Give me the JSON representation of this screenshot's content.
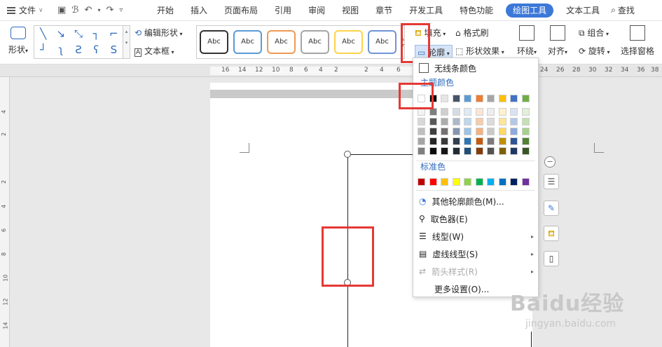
{
  "menubar": {
    "file_label": "文件",
    "tabs": [
      "开始",
      "插入",
      "页面布局",
      "引用",
      "审阅",
      "视图",
      "章节",
      "开发工具",
      "特色功能",
      "绘图工具",
      "文本工具"
    ],
    "active_tab": "绘图工具",
    "search_label": "查找"
  },
  "ribbon": {
    "shape_label": "形状",
    "edit_shape_label": "编辑形状",
    "textbox_label": "文本框",
    "style_samples": [
      "Abc",
      "Abc",
      "Abc",
      "Abc",
      "Abc",
      "Abc"
    ],
    "fill_label": "填充",
    "outline_label": "轮廓",
    "format_brush_label": "格式刷",
    "shape_effect_label": "形状效果",
    "wrap_label": "环绕",
    "align_label": "对齐",
    "group_label": "组合",
    "rotate_label": "旋转",
    "selection_pane_label": "选择窗格"
  },
  "ruler": {
    "h_ticks": [
      "16",
      "14",
      "12",
      "10",
      "8",
      "6",
      "4",
      "2",
      "2",
      "4",
      "6",
      "24",
      "26",
      "28",
      "30",
      "32",
      "34",
      "36",
      "38"
    ],
    "v_ticks": [
      "4",
      "2",
      "2",
      "4",
      "6",
      "8",
      "10",
      "12",
      "14"
    ]
  },
  "dropdown": {
    "no_line_color": "无线条颜色",
    "theme_colors_label": "主题颜色",
    "standard_colors_label": "标准色",
    "more_outline_colors": "其他轮廓颜色(M)...",
    "eyedropper": "取色器(E)",
    "line_type": "线型(W)",
    "dash_type": "虚线线型(S)",
    "arrow_style": "箭头样式(R)",
    "more_settings": "更多设置(O)..."
  },
  "theme_colors": {
    "base": [
      "#ffffff",
      "#000000",
      "#e7e6e6",
      "#44546a",
      "#5b9bd5",
      "#ed7d31",
      "#a5a5a5",
      "#ffc000",
      "#4472c4",
      "#70ad47"
    ],
    "tints": [
      [
        "#f2f2f2",
        "#7f7f7f",
        "#d0cece",
        "#d6dce4",
        "#deebf6",
        "#fbe5d5",
        "#ededed",
        "#fff2cc",
        "#dae3f3",
        "#e2efd9"
      ],
      [
        "#d8d8d8",
        "#595959",
        "#aeabab",
        "#adb9ca",
        "#bdd7ee",
        "#f7cbac",
        "#dbdbdb",
        "#fee599",
        "#b4c7e7",
        "#c5e0b3"
      ],
      [
        "#bfbfbf",
        "#3f3f3f",
        "#757070",
        "#8496b0",
        "#9dc3e6",
        "#f4b183",
        "#c9c9c9",
        "#ffd966",
        "#8eaadb",
        "#a8d08d"
      ],
      [
        "#a5a5a5",
        "#262626",
        "#3a3838",
        "#323f4f",
        "#2e75b5",
        "#c55a11",
        "#7b7b7b",
        "#bf9000",
        "#2f5496",
        "#538135"
      ],
      [
        "#7f7f7f",
        "#0c0c0c",
        "#171616",
        "#222a35",
        "#1e4e79",
        "#833c0b",
        "#525252",
        "#7f6000",
        "#1f3864",
        "#375623"
      ]
    ]
  },
  "standard_colors": [
    "#c00000",
    "#ff0000",
    "#ffc000",
    "#ffff00",
    "#92d050",
    "#00b050",
    "#00b0f0",
    "#0070c0",
    "#002060",
    "#7030a0"
  ],
  "watermark": {
    "brand": "Baidu经验",
    "url": "jingyan.baidu.com"
  }
}
